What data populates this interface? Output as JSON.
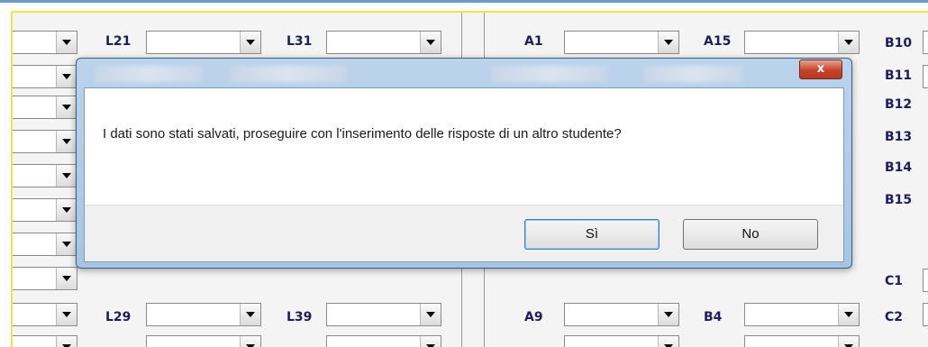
{
  "form": {
    "labels": {
      "l21": "L21",
      "l31": "L31",
      "a1": "A1",
      "a15": "A15",
      "b10": "B10",
      "b11": "B11",
      "b12": "B12",
      "b13": "B13",
      "b14": "B14",
      "b15": "B15",
      "c1": "C1",
      "c2": "C2",
      "l29": "L29",
      "l39": "L39",
      "a9": "A9",
      "b4": "B4"
    }
  },
  "dialog": {
    "message": "I dati sono stati salvati, proseguire con l'inserimento delle risposte di un altro studente?",
    "yes_label": "Sì",
    "no_label": "No",
    "close_glyph": "x"
  }
}
